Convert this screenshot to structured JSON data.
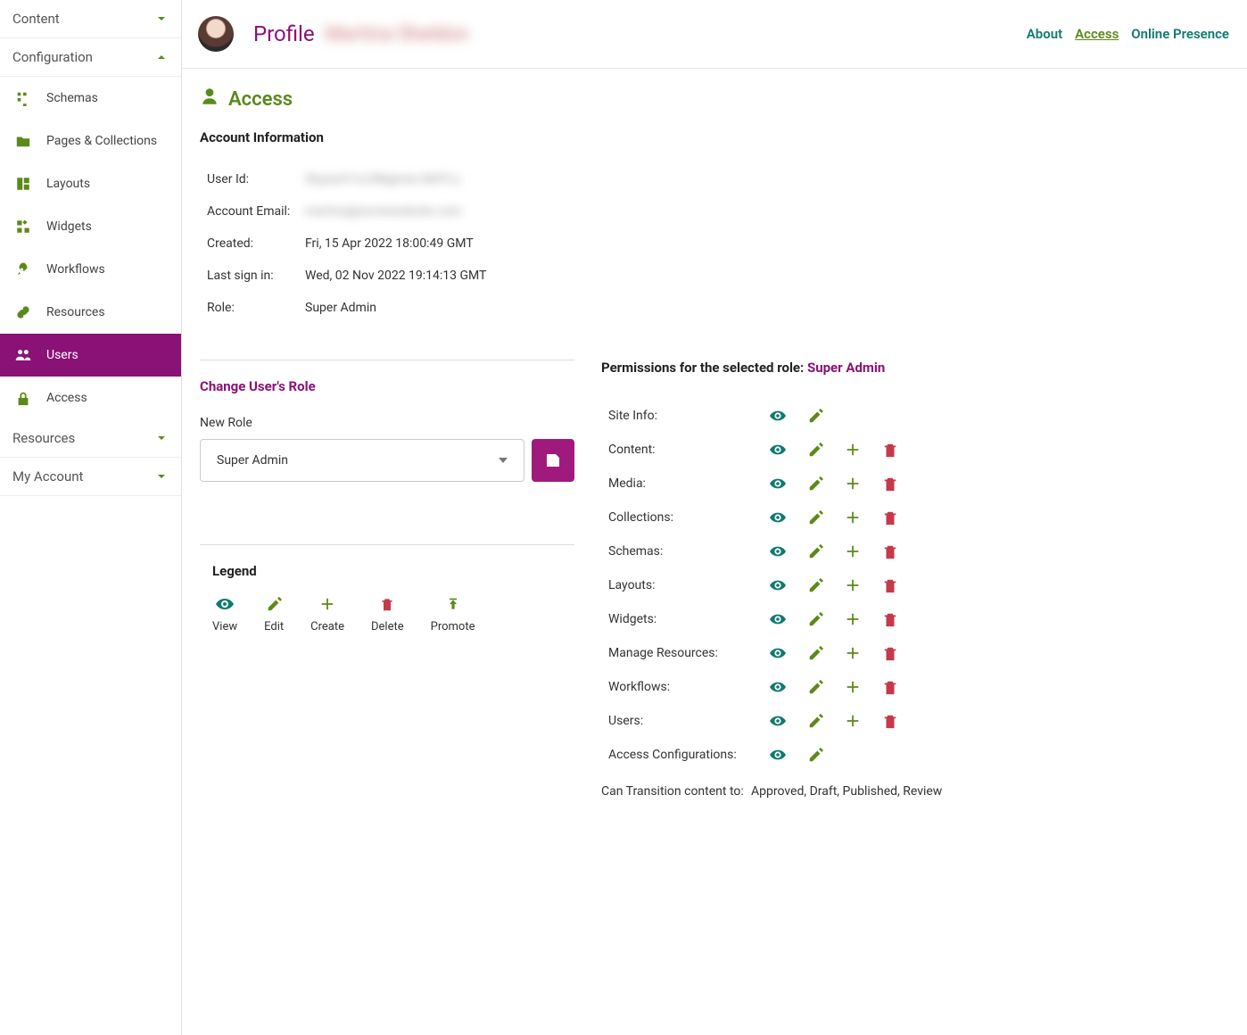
{
  "sidebar": {
    "content_group": "Content",
    "config_group": "Configuration",
    "items": [
      {
        "label": "Schemas"
      },
      {
        "label": "Pages & Collections"
      },
      {
        "label": "Layouts"
      },
      {
        "label": "Widgets"
      },
      {
        "label": "Workflows"
      },
      {
        "label": "Resources"
      },
      {
        "label": "Users"
      },
      {
        "label": "Access"
      }
    ],
    "resources_group": "Resources",
    "account_group": "My Account"
  },
  "header": {
    "title": "Profile",
    "name": "Martina Sheldon",
    "tabs": {
      "about": "About",
      "access": "Access",
      "online": "Online Presence"
    }
  },
  "section": {
    "title": "Access"
  },
  "account_info": {
    "heading": "Account Information",
    "rows": {
      "user_id": {
        "key": "User Id:",
        "val": "XbyauH1cL0Mgenev.MATLc"
      },
      "email": {
        "key": "Account Email:",
        "val": "martina@acmewebsite.com"
      },
      "created": {
        "key": "Created:",
        "val": "Fri, 15 Apr 2022 18:00:49 GMT"
      },
      "signin": {
        "key": "Last sign in:",
        "val": "Wed, 02 Nov 2022 19:14:13 GMT"
      },
      "role": {
        "key": "Role:",
        "val": "Super Admin"
      }
    }
  },
  "change_role": {
    "heading": "Change User's Role",
    "label": "New Role",
    "selected": "Super Admin"
  },
  "legend": {
    "heading": "Legend",
    "items": {
      "view": "View",
      "edit": "Edit",
      "create": "Create",
      "delete": "Delete",
      "promote": "Promote"
    }
  },
  "permissions": {
    "heading": "Permissions for the selected role: ",
    "role": "Super Admin",
    "rows": [
      {
        "name": "Site Info:",
        "perms": [
          "view",
          "edit"
        ]
      },
      {
        "name": "Content:",
        "perms": [
          "view",
          "edit",
          "create",
          "delete"
        ]
      },
      {
        "name": "Media:",
        "perms": [
          "view",
          "edit",
          "create",
          "delete"
        ]
      },
      {
        "name": "Collections:",
        "perms": [
          "view",
          "edit",
          "create",
          "delete"
        ]
      },
      {
        "name": "Schemas:",
        "perms": [
          "view",
          "edit",
          "create",
          "delete"
        ]
      },
      {
        "name": "Layouts:",
        "perms": [
          "view",
          "edit",
          "create",
          "delete"
        ]
      },
      {
        "name": "Widgets:",
        "perms": [
          "view",
          "edit",
          "create",
          "delete"
        ]
      },
      {
        "name": "Manage Resources:",
        "perms": [
          "view",
          "edit",
          "create",
          "delete"
        ]
      },
      {
        "name": "Workflows:",
        "perms": [
          "view",
          "edit",
          "create",
          "delete"
        ]
      },
      {
        "name": "Users:",
        "perms": [
          "view",
          "edit",
          "create",
          "delete"
        ]
      },
      {
        "name": "Access Configurations:",
        "perms": [
          "view",
          "edit"
        ]
      }
    ],
    "transition_label": "Can Transition content to:",
    "transition_value": "Approved, Draft, Published, Review"
  }
}
